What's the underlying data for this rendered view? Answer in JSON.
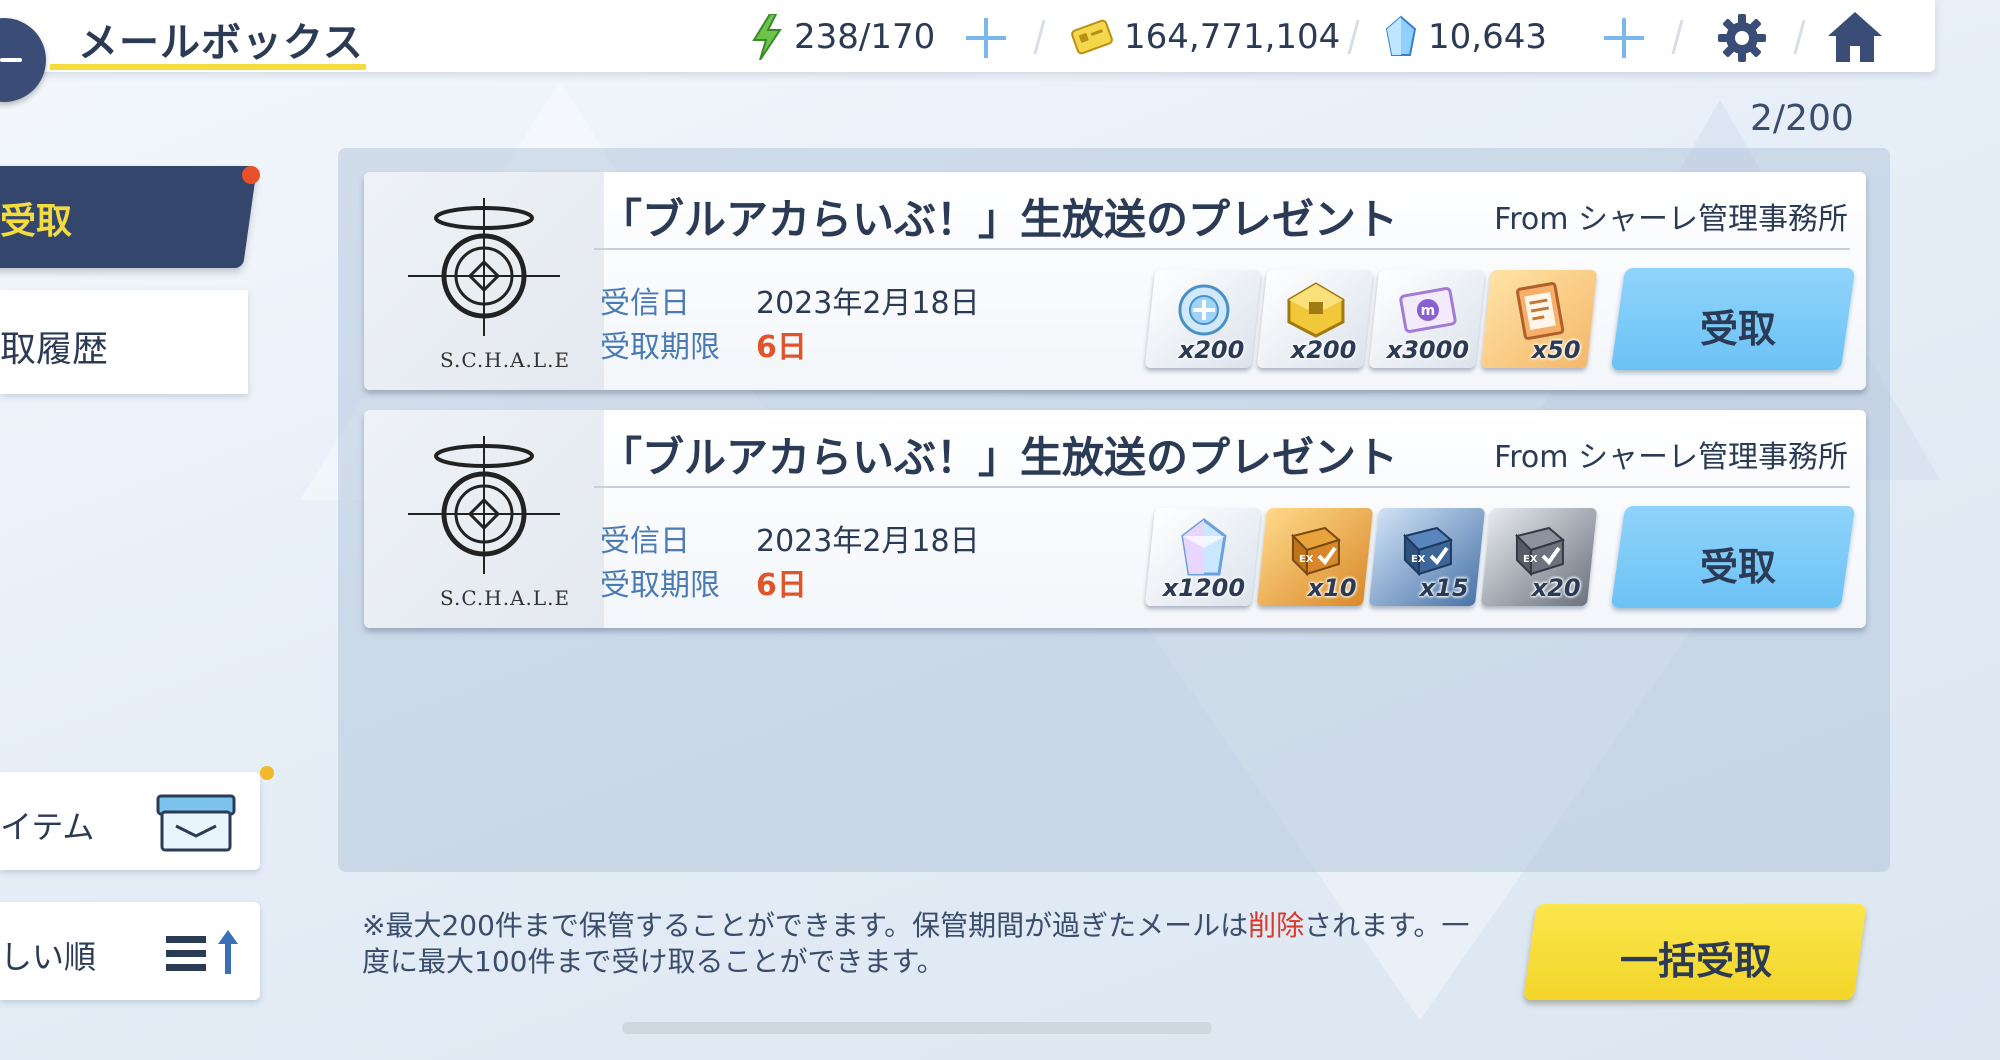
{
  "header": {
    "title": "メールボックス",
    "resources": [
      {
        "name": "energy",
        "icon": "lightning-icon",
        "value": "238/170",
        "has_plus": true
      },
      {
        "name": "credits",
        "icon": "credit-card-icon",
        "value": "164,771,104",
        "has_plus": false
      },
      {
        "name": "pyroxene",
        "icon": "crystal-icon",
        "value": "10,643",
        "has_plus": true
      }
    ]
  },
  "sidebar": {
    "tabs": [
      {
        "label": "受取",
        "active": true
      },
      {
        "label": "取履歴",
        "active": false
      }
    ],
    "filter_label": "イテム",
    "sort_label": "しい順"
  },
  "count": "2/200",
  "mails": [
    {
      "logo_text": "S.C.H.A.L.E",
      "subject": "「ブルアカらいぶ！」生放送のプレゼント",
      "from": "From シャーレ管理事務所",
      "received_label": "受信日",
      "received": "2023年2月18日",
      "deadline_label": "受取期限",
      "deadline": "6日",
      "items": [
        {
          "icon": "tactical-support-icon",
          "qty": "x200"
        },
        {
          "icon": "gold-ticket-icon",
          "qty": "x200"
        },
        {
          "icon": "m-ticket-icon",
          "qty": "x3000"
        },
        {
          "icon": "report-clipboard-icon",
          "qty": "x50"
        }
      ],
      "claim_label": "受取"
    },
    {
      "logo_text": "S.C.H.A.L.E",
      "subject": "「ブルアカらいぶ！」生放送のプレゼント",
      "from": "From シャーレ管理事務所",
      "received_label": "受信日",
      "received": "2023年2月18日",
      "deadline_label": "受取期限",
      "deadline": "6日",
      "items": [
        {
          "icon": "pyroxene-crystal-icon",
          "qty": "x1200"
        },
        {
          "icon": "gold-ex-box-icon",
          "qty": "x10"
        },
        {
          "icon": "blue-ex-box-icon",
          "qty": "x15"
        },
        {
          "icon": "gray-ex-box-icon",
          "qty": "x20"
        }
      ],
      "claim_label": "受取"
    }
  ],
  "note": {
    "before": "※最大200件まで保管することができます。保管期間が過ぎたメールは",
    "red": "削除",
    "after": "されます。一度に最大100件まで受け取ることができます。"
  },
  "bulk_claim_label": "一括受取",
  "colors": {
    "nav_dark": "#34466b",
    "accent_yellow": "#f4dc3e",
    "claim_blue": "#7ac9f7",
    "alert_red": "#e0542a"
  }
}
